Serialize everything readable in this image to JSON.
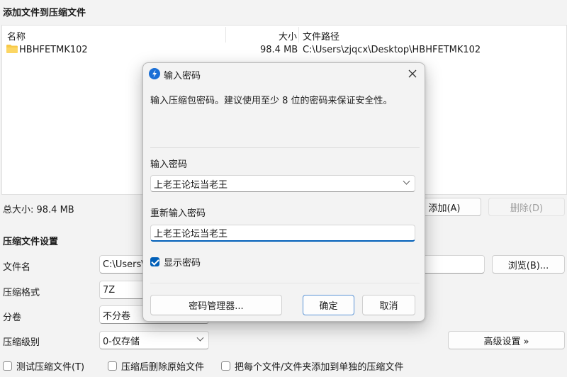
{
  "main": {
    "title": "添加文件到压缩文件",
    "list": {
      "headers": [
        "名称",
        "大小",
        "文件路径"
      ],
      "rows": [
        {
          "icon": "folder-icon",
          "name": "HBHFETMK102",
          "size": "98.4 MB",
          "path": "C:\\Users\\zjqcx\\Desktop\\HBHFETMK102"
        }
      ]
    },
    "total_size": "总大小: 98.4 MB",
    "add_button": "添加(A)",
    "delete_button": "删除(D)"
  },
  "settings": {
    "section_title": "压缩文件设置",
    "filename_label": "文件名",
    "filename_value": "C:\\Users\\",
    "browse_button": "浏览(B)...",
    "format_label": "压缩格式",
    "format_value": "7Z",
    "split_label": "分卷",
    "split_value": "不分卷",
    "level_label": "压缩级别",
    "level_value": "0-仅存储",
    "advanced_button": "高级设置 »",
    "checkboxes": [
      "测试压缩文件(T)",
      "压缩后删除原始文件",
      "把每个文件/文件夹添加到单独的压缩文件"
    ]
  },
  "dialog": {
    "title": "输入密码",
    "message": "输入压缩包密码。建议使用至少 8 位的密码来保证安全性。",
    "password_label": "输入密码",
    "password_value": "上老王论坛当老王",
    "confirm_label": "重新输入密码",
    "confirm_value": "上老王论坛当老王",
    "show_password": "显示密码",
    "manager_button": "密码管理器...",
    "ok_button": "确定",
    "cancel_button": "取消",
    "accent": "#005fb8"
  }
}
